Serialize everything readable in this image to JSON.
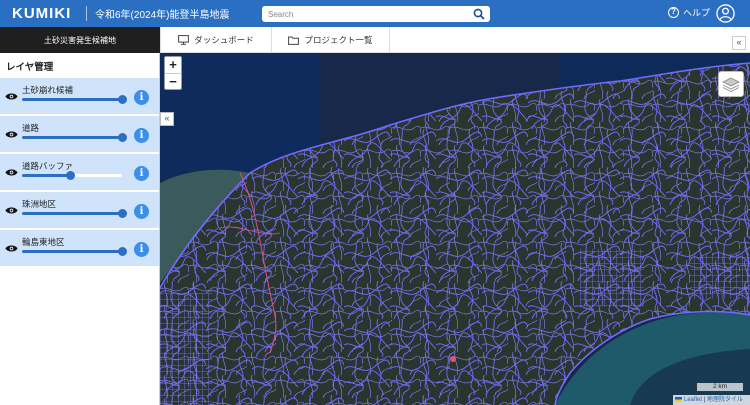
{
  "header": {
    "brand": "KUMIKI",
    "title": "令和6年(2024年)能登半島地震",
    "search_placeholder": "Search",
    "help_label": "ヘルプ"
  },
  "subbar": {
    "area_label": "土砂災害発生候補地",
    "tabs": [
      {
        "label": "ダッシュボード",
        "icon": "monitor-icon"
      },
      {
        "label": "プロジェクト一覧",
        "icon": "folder-icon"
      }
    ]
  },
  "sidebar": {
    "title": "レイヤ管理",
    "layers": [
      {
        "name": "土砂崩れ候補",
        "opacity": 1.0,
        "visible": true
      },
      {
        "name": "道路",
        "opacity": 1.0,
        "visible": true
      },
      {
        "name": "道路バッファ",
        "opacity": 0.5,
        "visible": true
      },
      {
        "name": "珠洲地区",
        "opacity": 1.0,
        "visible": true
      },
      {
        "name": "輪島東地区",
        "opacity": 1.0,
        "visible": true
      }
    ]
  },
  "map": {
    "zoom_in": "+",
    "zoom_out": "−",
    "scale_label": "2 km",
    "attribution_leaflet": "Leaflet",
    "attribution_separator": "|",
    "attribution_tiles": "地理院タイル"
  },
  "colors": {
    "header": "#2a6fc2",
    "layer_bg": "#cfe4fb",
    "info": "#3d8ee8",
    "roads": "#6f6cff",
    "buffer": "#e0507a"
  }
}
